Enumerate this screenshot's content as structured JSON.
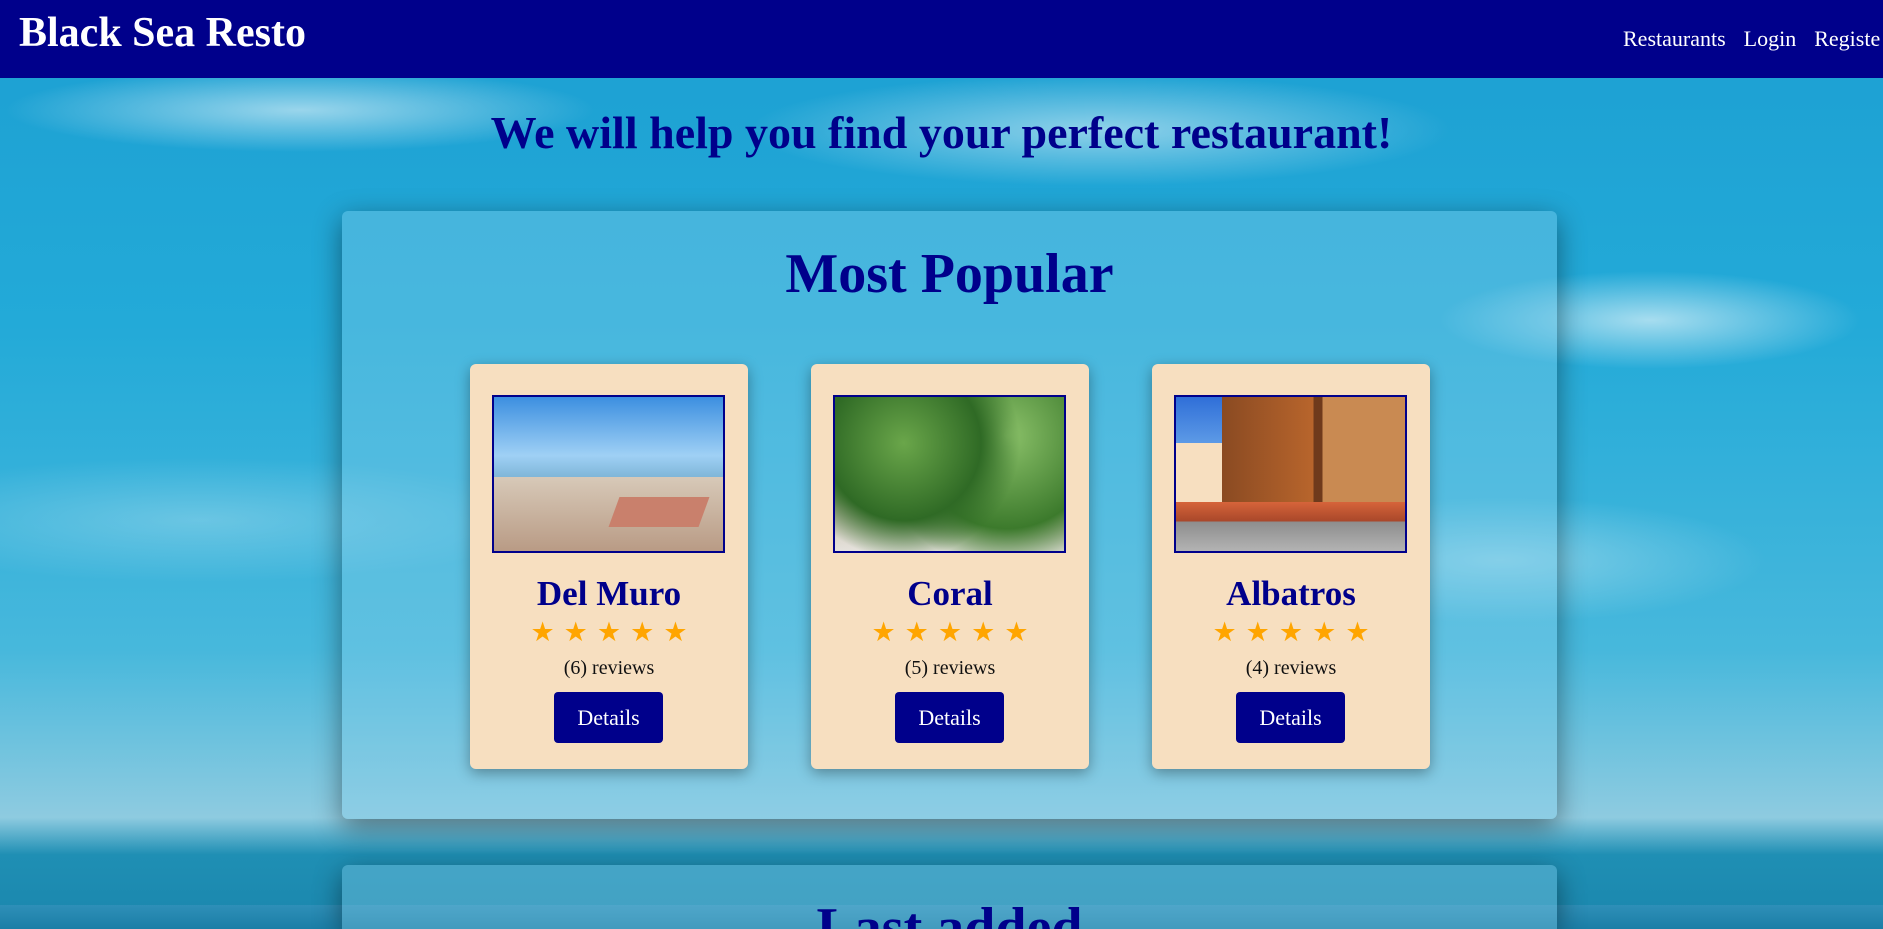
{
  "navbar": {
    "brand": "Black Sea Resto",
    "links": [
      "Restaurants",
      "Login",
      "Registe"
    ]
  },
  "hero": {
    "title": "We will help you find your perfect restaurant!"
  },
  "popular": {
    "title": "Most Popular",
    "cards": [
      {
        "name": "Del Muro",
        "rating": 5,
        "reviews": "(6) reviews",
        "button": "Details"
      },
      {
        "name": "Coral",
        "rating": 5,
        "reviews": "(5) reviews",
        "button": "Details"
      },
      {
        "name": "Albatros",
        "rating": 5,
        "reviews": "(4) reviews",
        "button": "Details"
      }
    ]
  },
  "latest": {
    "title": "Last added"
  },
  "colors": {
    "navbar": "#00008b",
    "card": "#f7dfc0",
    "star": "#ffa500"
  },
  "icons": {
    "star": "star-icon"
  }
}
